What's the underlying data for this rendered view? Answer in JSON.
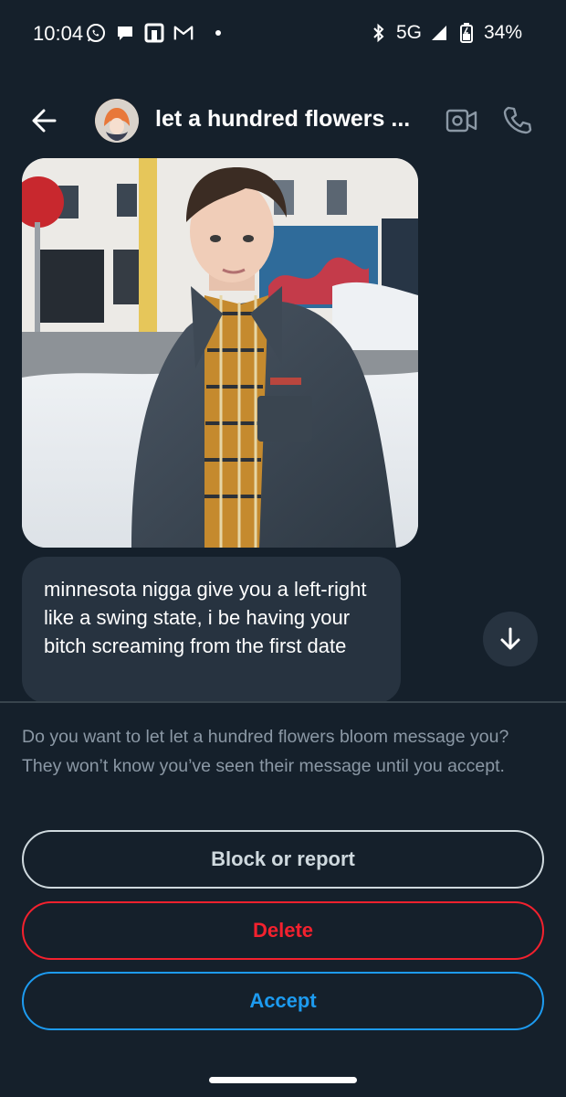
{
  "status_bar": {
    "time": "10:04",
    "network": "5G",
    "battery": "34%",
    "left_icons": [
      "whatsapp-icon",
      "chat-bubble-icon",
      "square-app-icon",
      "gmail-icon",
      "dot-icon"
    ],
    "right_icons": [
      "bluetooth-icon",
      "signal-icon",
      "battery-icon"
    ]
  },
  "header": {
    "title": "let a hundred flowers ...",
    "back_icon": "arrow-left-icon",
    "video_icon": "video-call-icon",
    "call_icon": "phone-icon"
  },
  "conversation": {
    "photo_alt": "photo-message",
    "message_text": "minnesota nigga give you a left-right like a swing state, i be having your bitch screaming from the first date",
    "scroll_icon": "arrow-down-icon"
  },
  "request": {
    "prompt": "Do you want to let let a hundred flowers bloom message you? They won’t know you’ve seen their message until you accept.",
    "block_label": "Block or report",
    "delete_label": "Delete",
    "accept_label": "Accept"
  },
  "colors": {
    "background": "#15202b",
    "bubble": "#273340",
    "muted_text": "#8b98a5",
    "delete_red": "#f4212e",
    "accept_blue": "#1d9bf0",
    "block_gray": "#cfd9de"
  }
}
